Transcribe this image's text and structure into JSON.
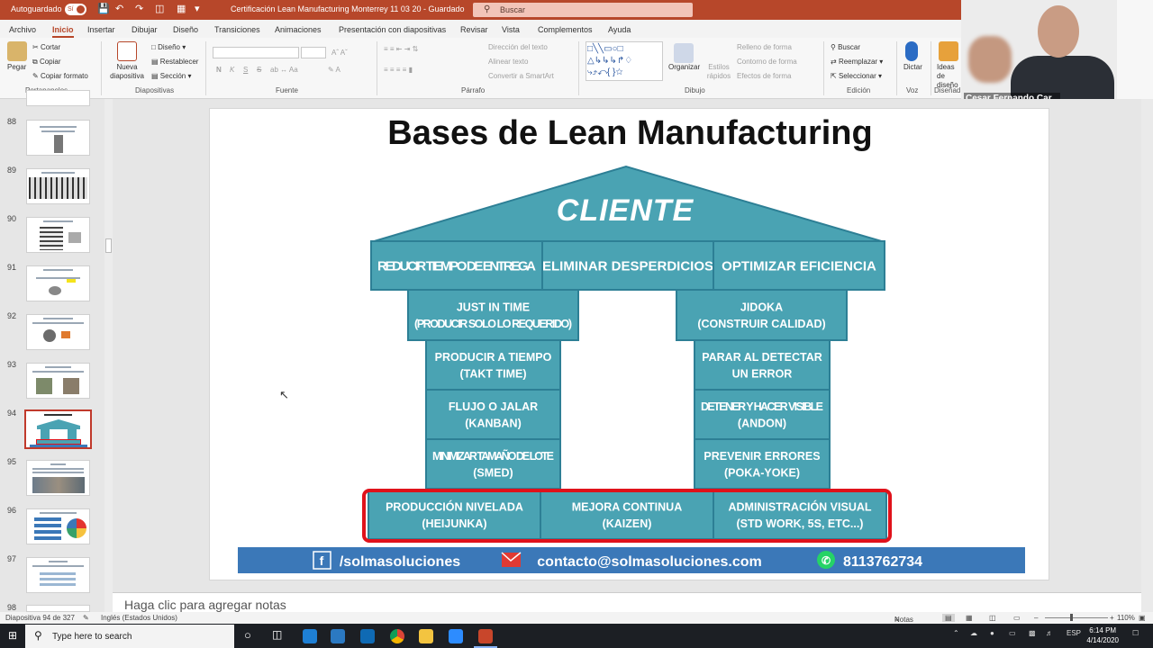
{
  "titlebar": {
    "autosave_label": "Autoguardado",
    "autosave_state": "Sí",
    "document_title": "Certificación Lean Manufacturing Monterrey 11 03 20  -  Guardado",
    "search_placeholder": "Buscar",
    "accent_color": "#b7472a"
  },
  "menu": {
    "items": [
      "Archivo",
      "Inicio",
      "Insertar",
      "Dibujar",
      "Diseño",
      "Transiciones",
      "Animaciones",
      "Presentación con diapositivas",
      "Revisar",
      "Vista",
      "Complementos",
      "Ayuda"
    ],
    "active_item": "Inicio"
  },
  "ribbon": {
    "clipboard": {
      "paste": "Pegar",
      "cut": "Cortar",
      "copy": "Copiar",
      "format_painter": "Copiar formato",
      "group": "Portapapeles"
    },
    "slides": {
      "new_slide": "Nueva diapositiva",
      "layout": "Diseño",
      "reset": "Restablecer",
      "section": "Sección",
      "group": "Diapositivas"
    },
    "font": {
      "group": "Fuente",
      "bold": "N",
      "italic": "K",
      "underline": "S",
      "strike": "S"
    },
    "paragraph": {
      "text_direction": "Dirección del texto",
      "align_text": "Alinear texto",
      "smartart": "Convertir a SmartArt",
      "group": "Párrafo"
    },
    "drawing": {
      "arrange": "Organizar",
      "quick_styles": "Estilos rápidos",
      "shape_fill": "Relleno de forma",
      "shape_outline": "Contorno de forma",
      "shape_effects": "Efectos de forma",
      "group": "Dibujo"
    },
    "editing": {
      "find": "Buscar",
      "replace": "Reemplazar",
      "select": "Seleccionar",
      "group": "Edición"
    },
    "voice": {
      "dictate": "Dictar",
      "group": "Voz"
    },
    "designer": {
      "ideas": "Ideas de diseño",
      "group": "Diseñad"
    }
  },
  "webcam": {
    "name": "Cesar Fernando Car..."
  },
  "thumbnails": [
    {
      "num": "88",
      "title": "¿Es lo mismo el Takt Time y el Tiempo de Ciclo?"
    },
    {
      "num": "89",
      "title": "Tabla de trabajo combinado"
    },
    {
      "num": "90",
      "title": "Contenido de Trabajo"
    },
    {
      "num": "91",
      "title": "Creatividad en Soluciones"
    },
    {
      "num": "92",
      "title": "Trabajo Estandarizado"
    },
    {
      "num": "93",
      "title": "Administración Visual"
    },
    {
      "num": "94",
      "title": "Bases de Lean Manufacturing"
    },
    {
      "num": "95",
      "title": "5S"
    },
    {
      "num": "96",
      "title": "Ruta de implementación de 5S"
    },
    {
      "num": "97",
      "title": "Definición"
    },
    {
      "num": "98",
      "title": ""
    }
  ],
  "slide": {
    "title": "Bases de Lean Manufacturing",
    "roof": "CLIENTE",
    "beam": [
      "REDUCIR TIEMPO DE ENTREGA",
      "ELIMINAR DESPERDICIOS",
      "OPTIMIZAR EFICIENCIA"
    ],
    "left_capital": [
      "JUST IN TIME",
      "(PRODUCIR SOLO LO REQUERIDO)"
    ],
    "right_capital": [
      "JIDOKA",
      "(CONSTRUIR CALIDAD)"
    ],
    "left_pillar": [
      [
        "PRODUCIR A TIEMPO",
        "(TAKT TIME)"
      ],
      [
        "FLUJO O JALAR",
        "(KANBAN)"
      ],
      [
        "MINIMIZAR TAMAÑO DE LOTE",
        "(SMED)"
      ]
    ],
    "right_pillar": [
      [
        "PARAR AL DETECTAR",
        "UN ERROR"
      ],
      [
        "DETENER Y HACER VISIBLE",
        "(ANDON)"
      ],
      [
        "PREVENIR ERRORES",
        "(POKA-YOKE)"
      ]
    ],
    "base": [
      [
        "PRODUCCIÓN NIVELADA",
        "(HEIJUNKA)"
      ],
      [
        "MEJORA CONTINUA",
        "(KAIZEN)"
      ],
      [
        "ADMINISTRACIÓN VISUAL",
        "(STD WORK, 5S, ETC...)"
      ]
    ],
    "footer": {
      "facebook": "/solmasoluciones",
      "email": "contacto@solmasoluciones.com",
      "whatsapp": "8113762734"
    },
    "colors": {
      "house": "#4aa3b3",
      "house_border": "#2d7f95",
      "footer": "#3b78b8",
      "highlight": "#e0121b"
    }
  },
  "notes_placeholder": "Haga clic para agregar notas",
  "statusbar": {
    "slide_info": "Diapositiva 94 de 327",
    "language": "Inglés (Estados Unidos)",
    "notes": "Notas",
    "zoom": "110%"
  },
  "taskbar": {
    "search": "Type here to search",
    "lang": "ESP",
    "time": "6:14 PM",
    "date": "4/14/2020"
  }
}
